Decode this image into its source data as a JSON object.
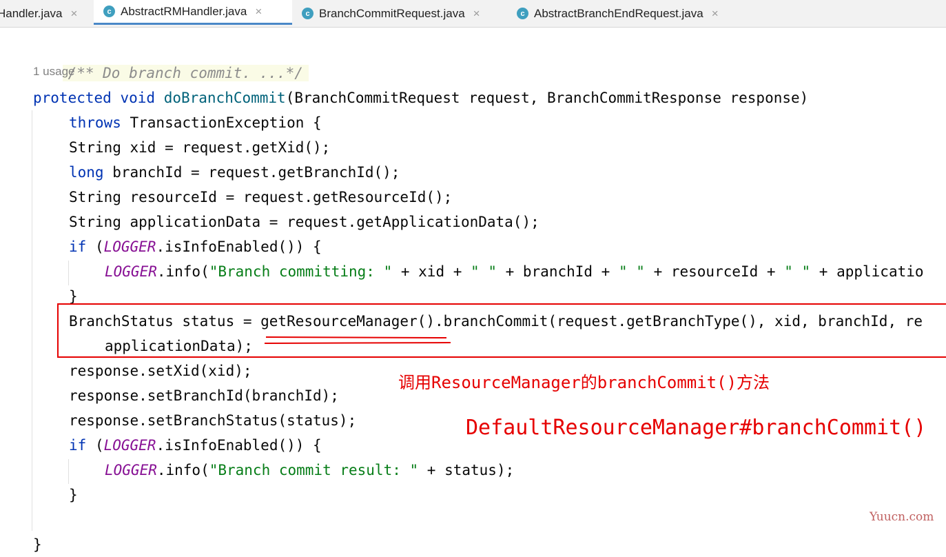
{
  "tabs": [
    {
      "label": "Handler.java",
      "icon": "class-icon",
      "active": false
    },
    {
      "label": "AbstractRMHandler.java",
      "icon": "class-icon",
      "active": true
    },
    {
      "label": "BranchCommitRequest.java",
      "icon": "class-icon",
      "active": false
    },
    {
      "label": "AbstractBranchEndRequest.java",
      "icon": "class-icon",
      "active": false
    }
  ],
  "tab_close_glyph": "×",
  "class_icon_glyph": "c",
  "usage_hint": "1 usage",
  "code": {
    "doc_comment": "/** Do branch commit. ...*/",
    "l1": {
      "kw1": "protected",
      "kw2": "void",
      "fn": "doBranchCommit",
      "rest": "(BranchCommitRequest request, BranchCommitResponse response)"
    },
    "l2": {
      "kw": "throws",
      "rest": " TransactionException {"
    },
    "l3": "String xid = request.getXid();",
    "l4": {
      "kw": "long",
      "rest": " branchId = request.getBranchId();"
    },
    "l5": "String resourceId = request.getResourceId();",
    "l6": "String applicationData = request.getApplicationData();",
    "l7": {
      "kw": "if",
      "p1": " (",
      "logger": "LOGGER",
      "rest": ".isInfoEnabled()) {"
    },
    "l8": {
      "logger": "LOGGER",
      "a": ".info(",
      "s1": "\"Branch committing: \"",
      "b": " + xid + ",
      "s2": "\" \"",
      "c": " + branchId + ",
      "s3": "\" \"",
      "d": " + resourceId + ",
      "s4": "\" \"",
      "e": " + applicatio"
    },
    "l9": "}",
    "l10": "BranchStatus status = getResourceManager().branchCommit(request.getBranchType(), xid, branchId, re",
    "l11": "applicationData);",
    "l12": "response.setXid(xid);",
    "l13": "response.setBranchId(branchId);",
    "l14": "response.setBranchStatus(status);",
    "l15": {
      "kw": "if",
      "p1": " (",
      "logger": "LOGGER",
      "rest": ".isInfoEnabled()) {"
    },
    "l16": {
      "logger": "LOGGER",
      "a": ".info(",
      "s1": "\"Branch commit result: \"",
      "b": " + status);"
    },
    "l17": "}",
    "l18": "}"
  },
  "annotations": {
    "note1": "调用ResourceManager的branchCommit()方法",
    "note2": "DefaultResourceManager#branchCommit()"
  },
  "watermark": "Yuucn.com",
  "colors": {
    "keyword": "#0033b3",
    "method": "#00627a",
    "string": "#067d17",
    "static_field": "#871094",
    "annotation_red": "#e60000",
    "tab_accent": "#4a88c7"
  }
}
